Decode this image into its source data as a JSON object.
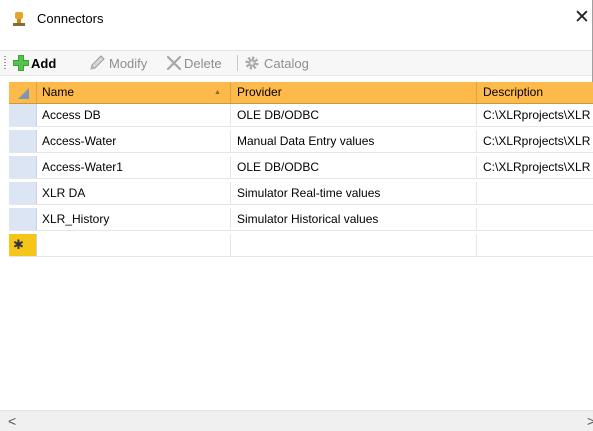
{
  "window": {
    "title": "Connectors",
    "close_glyph": "✕"
  },
  "toolbar": {
    "add": {
      "label": "Add",
      "icon": "plus-icon",
      "enabled": true
    },
    "modify": {
      "label": "Modify",
      "icon": "pencil-icon",
      "enabled": false
    },
    "delete": {
      "label": "Delete",
      "icon": "delete-x-icon",
      "enabled": false
    },
    "catalog": {
      "label": "Catalog",
      "icon": "gear-icon",
      "enabled": false
    }
  },
  "grid": {
    "columns": {
      "name": "Name",
      "provider": "Provider",
      "description": "Description"
    },
    "sort_indicator": "▲",
    "rows": [
      {
        "name": "Access DB",
        "provider": "OLE DB/ODBC",
        "description": "C:\\XLRprojects\\XLR"
      },
      {
        "name": "Access-Water",
        "provider": "Manual Data Entry values",
        "description": "C:\\XLRprojects\\XLR"
      },
      {
        "name": "Access-Water1",
        "provider": "OLE DB/ODBC",
        "description": "C:\\XLRprojects\\XLR"
      },
      {
        "name": "XLR DA",
        "provider": "Simulator Real-time values",
        "description": ""
      },
      {
        "name": "XLR_History",
        "provider": "Simulator Historical values",
        "description": ""
      }
    ],
    "new_row_marker": "✱"
  },
  "scrollbar": {
    "left": "<",
    "right": ">"
  },
  "colors": {
    "header": "#fdb94a",
    "row_header": "#dce5f3",
    "new_row": "#f5c518",
    "add_icon": "#3aa335"
  }
}
